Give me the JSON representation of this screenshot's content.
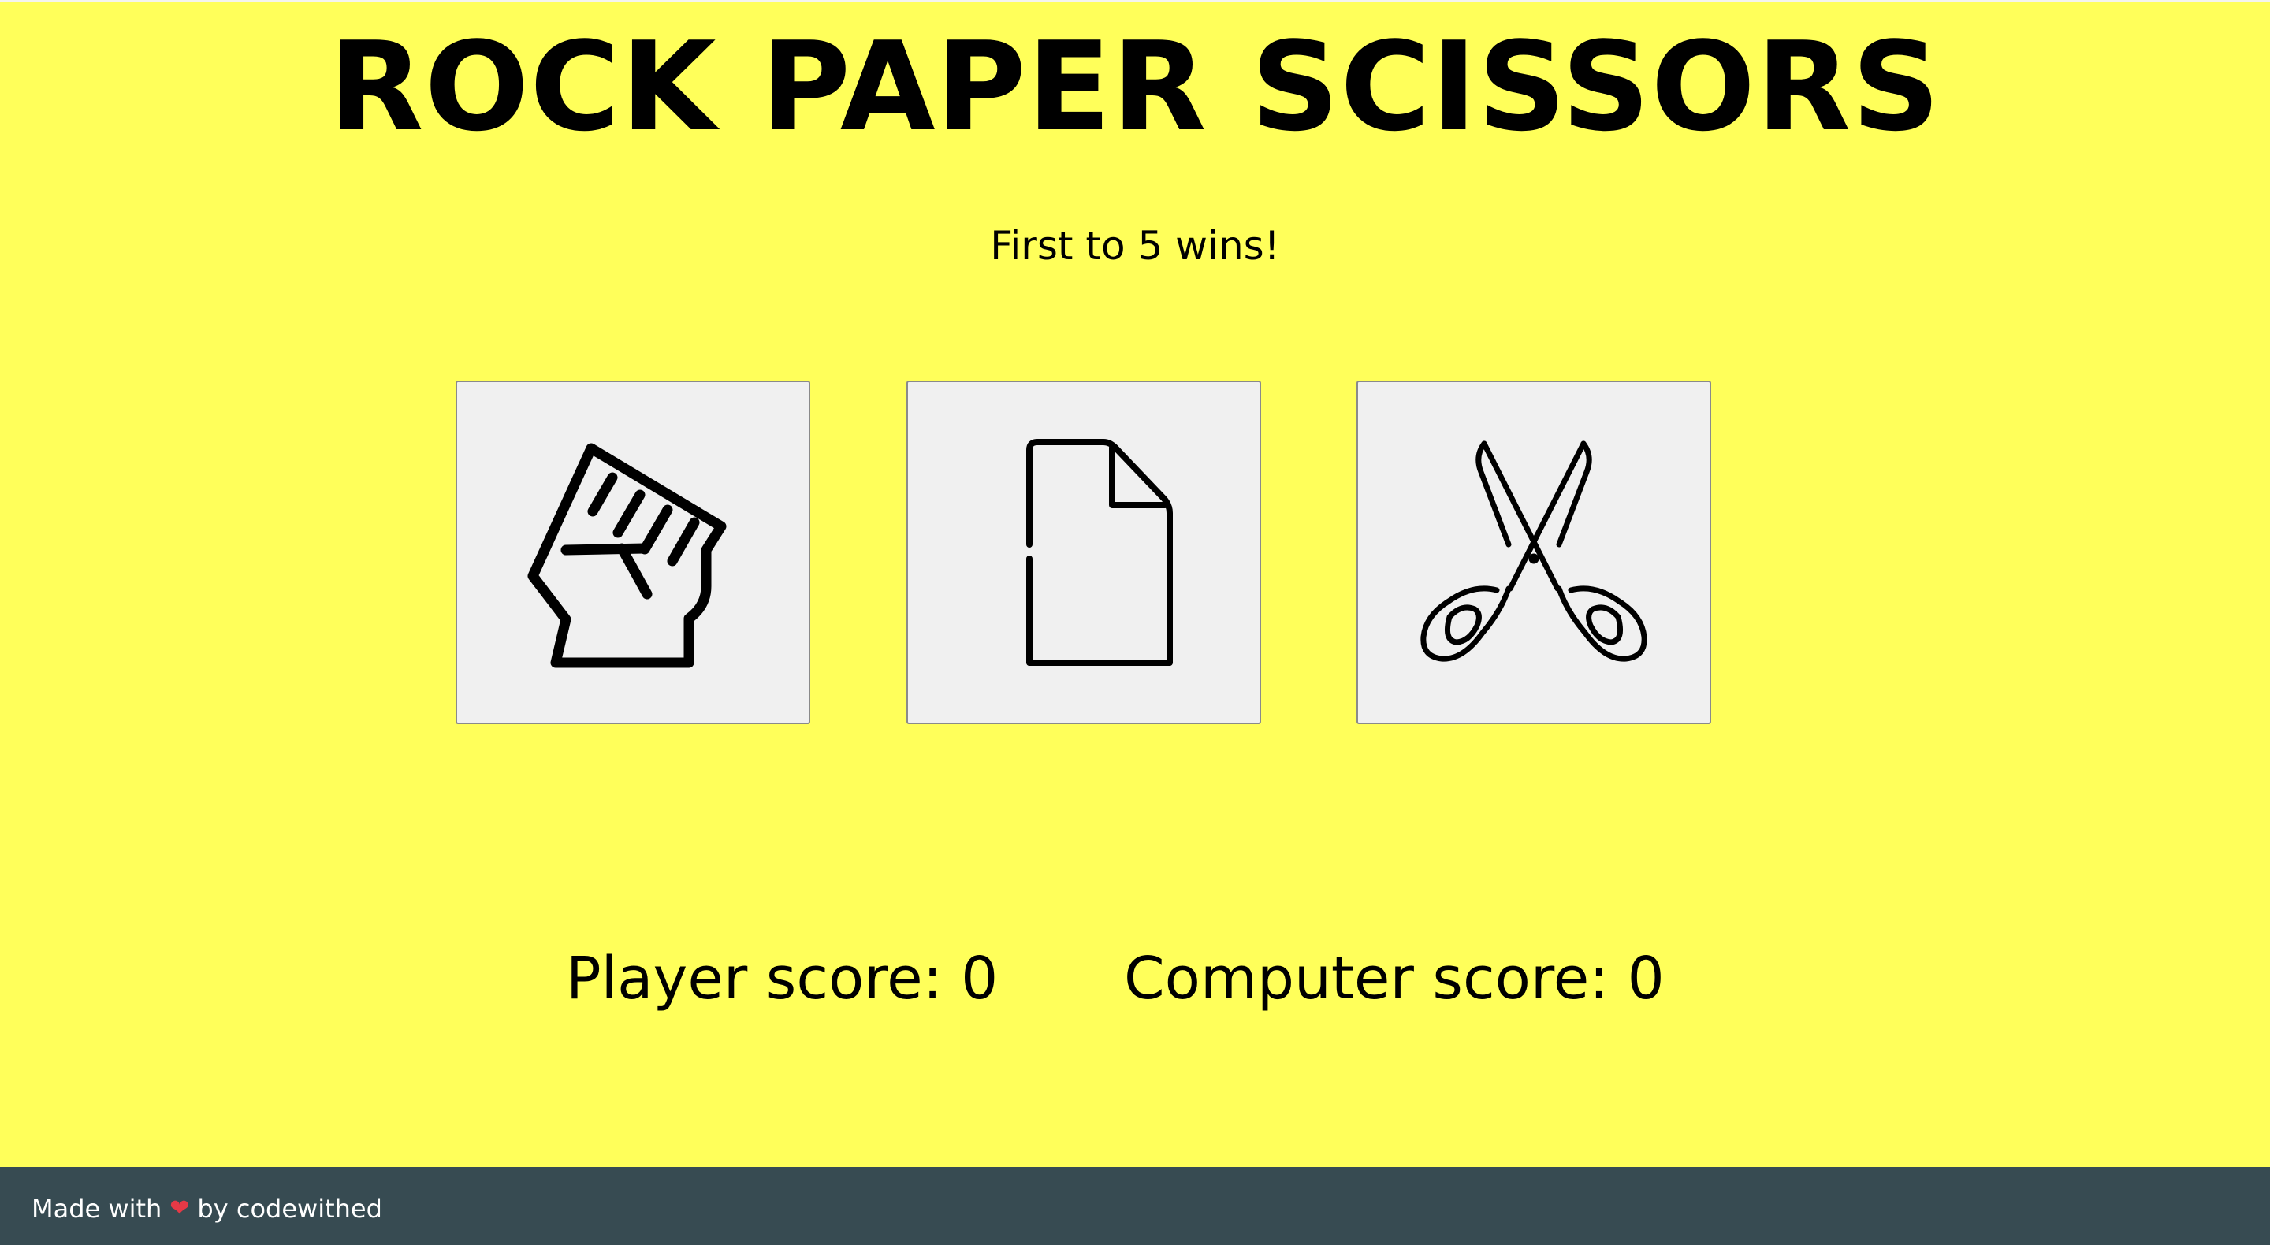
{
  "page": {
    "title": "ROCK PAPER SCISSORS",
    "subtitle": "First to 5 wins!",
    "background_color": "#ffff5a"
  },
  "choices": [
    {
      "id": "rock",
      "icon": "rock-fist-icon"
    },
    {
      "id": "paper",
      "icon": "paper-sheet-icon"
    },
    {
      "id": "scissors",
      "icon": "scissors-icon"
    }
  ],
  "scores": {
    "player_label": "Player score: 0",
    "computer_label": "Computer score: 0"
  },
  "footer": {
    "made_with": "Made with",
    "heart": "❤",
    "by_text": "by codewithed",
    "background_color": "#374b52",
    "heart_color": "#e63946"
  }
}
